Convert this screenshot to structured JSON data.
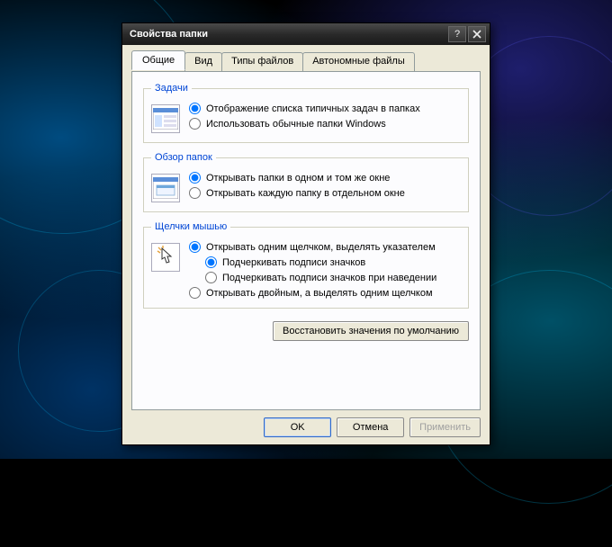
{
  "window": {
    "title": "Свойства папки"
  },
  "tabs": [
    {
      "label": "Общие",
      "active": true
    },
    {
      "label": "Вид",
      "active": false
    },
    {
      "label": "Типы файлов",
      "active": false
    },
    {
      "label": "Автономные файлы",
      "active": false
    }
  ],
  "groups": {
    "tasks": {
      "legend": "Задачи",
      "options": [
        {
          "label": "Отображение списка типичных задач в папках",
          "checked": true
        },
        {
          "label": "Использовать обычные папки Windows",
          "checked": false
        }
      ]
    },
    "browse": {
      "legend": "Обзор папок",
      "options": [
        {
          "label": "Открывать папки в одном и том же окне",
          "checked": true
        },
        {
          "label": "Открывать каждую папку в отдельном окне",
          "checked": false
        }
      ]
    },
    "click": {
      "legend": "Щелчки мышью",
      "options": [
        {
          "label": "Открывать одним щелчком, выделять указателем",
          "checked": true
        },
        {
          "label": "Открывать двойным, а выделять одним щелчком",
          "checked": false
        }
      ],
      "sub_options": [
        {
          "label": "Подчеркивать подписи значков",
          "checked": true
        },
        {
          "label": "Подчеркивать подписи значков при наведении",
          "checked": false
        }
      ]
    }
  },
  "buttons": {
    "restore": "Восстановить значения по умолчанию",
    "ok": "OK",
    "cancel": "Отмена",
    "apply": "Применить"
  }
}
